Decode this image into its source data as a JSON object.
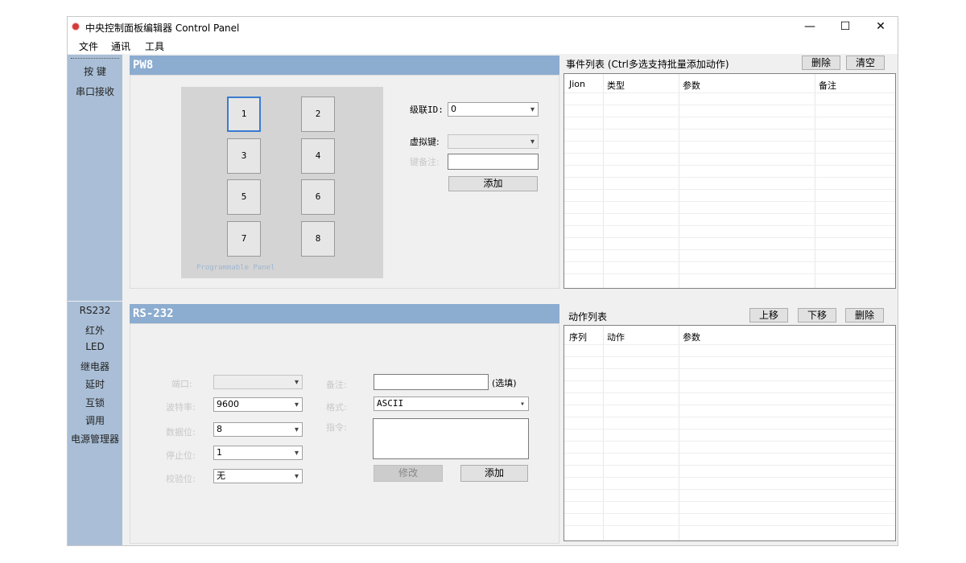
{
  "window": {
    "title": "中央控制面板编辑器 Control Panel",
    "minimize": "—",
    "maximize": "☐",
    "close": "✕"
  },
  "menu": [
    "文件",
    "通讯",
    "工具"
  ],
  "sidebar_top": [
    "按 键",
    "串口接收"
  ],
  "sidebar_bottom": [
    "RS232",
    "红外",
    "LED",
    "继电器",
    "延时",
    "互锁",
    "调用",
    "电源管理器"
  ],
  "pw8": {
    "title": "PW8",
    "keys": [
      "1",
      "2",
      "3",
      "4",
      "5",
      "6",
      "7",
      "8"
    ],
    "panel_label": "Programmable Panel",
    "cascade_label": "级联ID:",
    "cascade_value": "0",
    "virtual_key_label": "虚拟键:",
    "virtual_key_value": "",
    "key_note_label": "键备注:",
    "key_note_value": "",
    "add_label": "添加"
  },
  "event_list": {
    "title": "事件列表 (Ctrl多选支持批量添加动作)",
    "delete_label": "删除",
    "clear_label": "清空",
    "columns": [
      "Jion",
      "类型",
      "参数",
      "备注"
    ],
    "rows": []
  },
  "rs232": {
    "title": "RS-232",
    "port_label": "端口:",
    "port_value": "",
    "baud_label": "波特率:",
    "baud_value": "9600",
    "data_bits_label": "数据位:",
    "data_bits_value": "8",
    "stop_bits_label": "停止位:",
    "stop_bits_value": "1",
    "parity_label": "校验位:",
    "parity_value": "无",
    "note_label": "备注:",
    "note_value": "",
    "optional_hint": "(选填)",
    "format_label": "格式:",
    "format_value": "ASCII",
    "command_label": "指令:",
    "command_value": "",
    "modify_label": "修改",
    "add_label": "添加"
  },
  "action_list": {
    "title": "动作列表",
    "up_label": "上移",
    "down_label": "下移",
    "delete_label": "删除",
    "columns": [
      "序列",
      "动作",
      "参数"
    ],
    "rows": []
  },
  "colors": {
    "sidebar": "#aabfd7",
    "panel_header": "#8cacd0",
    "selected_key": "#3a7bd0",
    "app_icon": "#d43a3a"
  }
}
